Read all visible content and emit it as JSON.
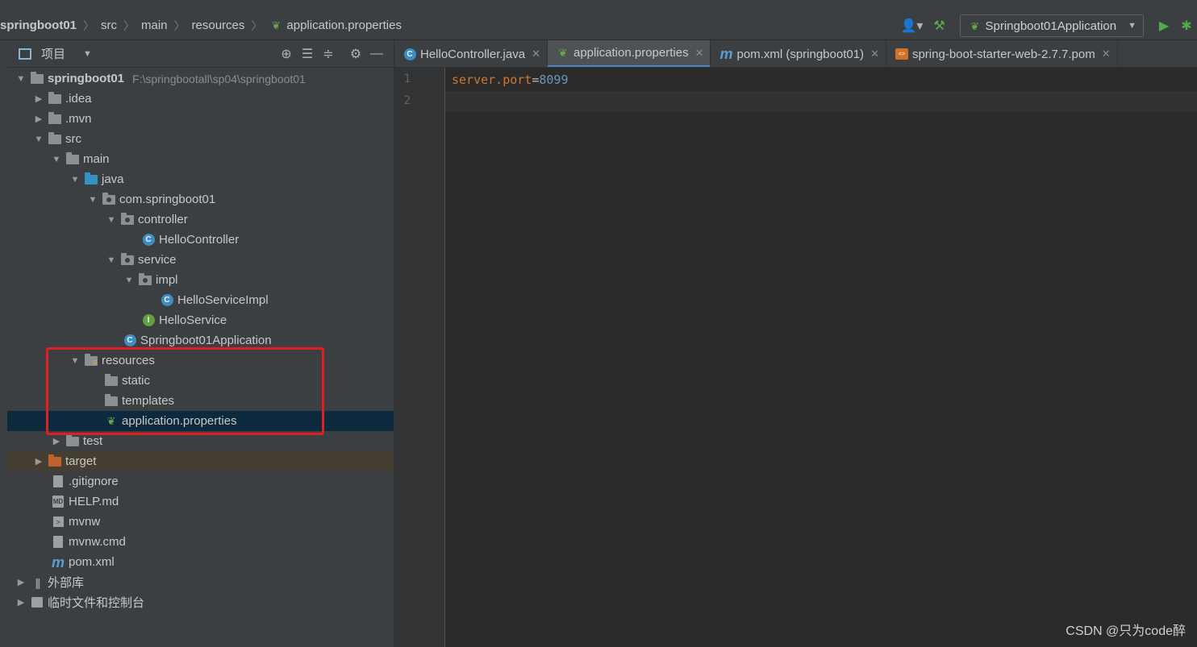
{
  "breadcrumbs": [
    "springboot01",
    "src",
    "main",
    "resources",
    "application.properties"
  ],
  "run_config": {
    "label": "Springboot01Application"
  },
  "project_panel": {
    "title": "项目",
    "tree": [
      {
        "label": "springboot01",
        "path": "F:\\springbootall\\sp04\\springboot01",
        "icon": "module-folder-icon",
        "expanded": true
      },
      {
        "label": ".idea",
        "icon": "folder-icon",
        "expanded": false
      },
      {
        "label": ".mvn",
        "icon": "folder-icon",
        "expanded": false
      },
      {
        "label": "src",
        "icon": "folder-icon",
        "expanded": true
      },
      {
        "label": "main",
        "icon": "folder-icon",
        "expanded": true
      },
      {
        "label": "java",
        "icon": "source-folder-icon",
        "expanded": true
      },
      {
        "label": "com.springboot01",
        "icon": "package-icon",
        "expanded": true
      },
      {
        "label": "controller",
        "icon": "package-icon",
        "expanded": true
      },
      {
        "label": "HelloController",
        "icon": "class-icon"
      },
      {
        "label": "service",
        "icon": "package-icon",
        "expanded": true
      },
      {
        "label": "impl",
        "icon": "package-icon",
        "expanded": true
      },
      {
        "label": "HelloServiceImpl",
        "icon": "class-icon"
      },
      {
        "label": "HelloService",
        "icon": "interface-icon"
      },
      {
        "label": "Springboot01Application",
        "icon": "spring-boot-class-icon"
      },
      {
        "label": "resources",
        "icon": "resources-folder-icon",
        "expanded": true
      },
      {
        "label": "static",
        "icon": "folder-icon"
      },
      {
        "label": "templates",
        "icon": "folder-icon"
      },
      {
        "label": "application.properties",
        "icon": "spring-properties-icon",
        "selected": true
      },
      {
        "label": "test",
        "icon": "folder-icon",
        "expanded": false
      },
      {
        "label": "target",
        "icon": "excluded-folder-icon",
        "expanded": false
      },
      {
        "label": ".gitignore",
        "icon": "gitignore-file-icon"
      },
      {
        "label": "HELP.md",
        "icon": "markdown-file-icon"
      },
      {
        "label": "mvnw",
        "icon": "shell-script-icon"
      },
      {
        "label": "mvnw.cmd",
        "icon": "text-file-icon"
      },
      {
        "label": "pom.xml",
        "icon": "maven-icon"
      },
      {
        "label": "外部库",
        "icon": "library-icon",
        "expanded": false
      },
      {
        "label": "临时文件和控制台",
        "icon": "scratches-icon",
        "expanded": false
      }
    ]
  },
  "tabs": [
    {
      "label": "HelloController.java",
      "icon": "class-icon",
      "active": false
    },
    {
      "label": "application.properties",
      "icon": "spring-properties-icon",
      "active": true
    },
    {
      "label": "pom.xml (springboot01)",
      "icon": "maven-icon",
      "active": false
    },
    {
      "label": "spring-boot-starter-web-2.7.7.pom",
      "icon": "xml-file-icon",
      "active": false
    }
  ],
  "editor": {
    "line_numbers": [
      "1",
      "2"
    ],
    "line1_key": "server.port",
    "line1_eq": "=",
    "line1_value": "8099"
  },
  "watermark": "CSDN @只为code醉",
  "colors": {
    "selection": "#0d293e",
    "highlight_box": "#e02020",
    "accent": "#4a88c7"
  }
}
